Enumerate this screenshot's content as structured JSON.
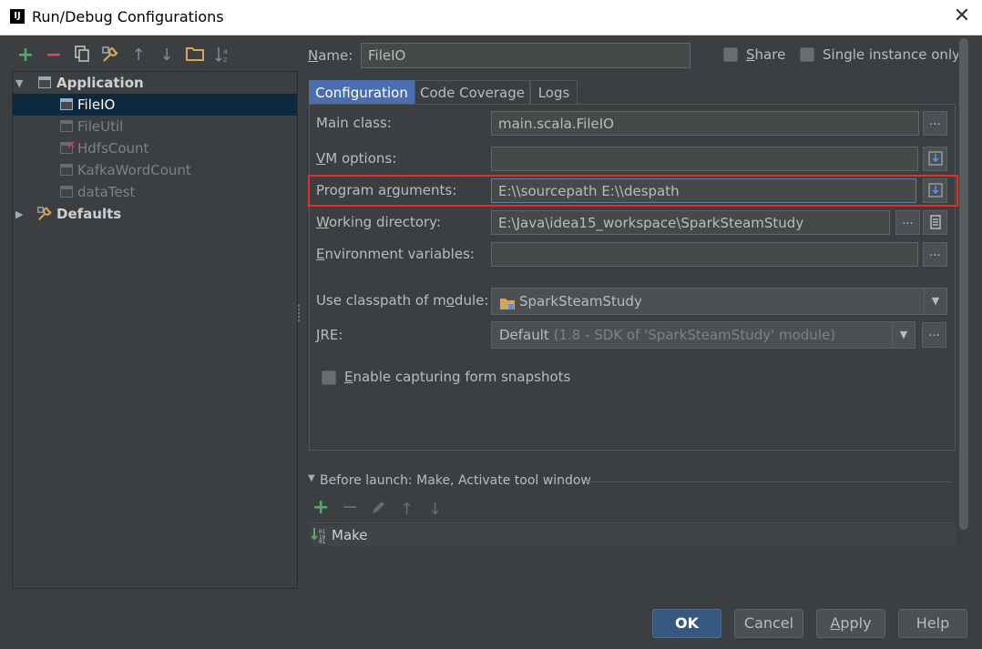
{
  "window": {
    "title": "Run/Debug Configurations",
    "app_icon_text": "IJ"
  },
  "tree": {
    "items": [
      {
        "label": "Application",
        "level": 0,
        "expanded": true,
        "bold": true
      },
      {
        "label": "FileIO",
        "level": 1,
        "selected": true
      },
      {
        "label": "FileUtil",
        "level": 1
      },
      {
        "label": "HdfsCount",
        "level": 1,
        "error": true
      },
      {
        "label": "KafkaWordCount",
        "level": 1
      },
      {
        "label": "dataTest",
        "level": 1
      },
      {
        "label": "Defaults",
        "level": 0,
        "expanded": false,
        "bold": true
      }
    ]
  },
  "toolbar": {
    "add": "+",
    "remove": "−",
    "copy": "copy-icon",
    "edit_defaults": "wrench-icon",
    "move_up": "↑",
    "move_down": "↓",
    "folder": "folder-icon",
    "sort": "sort-icon"
  },
  "header": {
    "name_label": "Name:",
    "name_value": "FileIO",
    "share_label": "Share",
    "single_instance_label": "Single instance only"
  },
  "tabs": [
    {
      "label": "Configuration",
      "active": true
    },
    {
      "label": "Code Coverage",
      "active": false
    },
    {
      "label": "Logs",
      "active": false
    }
  ],
  "config": {
    "main_class_label": "Main class:",
    "main_class_value": "main.scala.FileIO",
    "vm_options_label": "VM options:",
    "vm_options_value": "",
    "program_args_label": "Program arguments:",
    "program_args_value": "E:\\\\sourcepath E:\\\\despath",
    "working_dir_label": "Working directory:",
    "working_dir_value": "E:\\Java\\idea15_workspace\\SparkSteamStudy",
    "env_vars_label": "Environment variables:",
    "env_vars_value": "",
    "classpath_label": "Use classpath of module:",
    "classpath_value": "SparkSteamStudy",
    "jre_label": "JRE:",
    "jre_value": "Default",
    "jre_detail": "(1.8 - SDK of 'SparkSteamStudy' module)",
    "snapshots_label": "Enable capturing form snapshots",
    "ellipsis": "..."
  },
  "before_launch": {
    "header": "Before launch: Make, Activate tool window",
    "items": [
      "Make"
    ]
  },
  "buttons": {
    "ok": "OK",
    "cancel": "Cancel",
    "apply": "Apply",
    "help": "Help"
  },
  "colors": {
    "accent": "#4b6eaf",
    "highlight_box": "#e03030",
    "selection": "#0d293e",
    "add_green": "#59a869",
    "remove_red": "#c75450"
  }
}
